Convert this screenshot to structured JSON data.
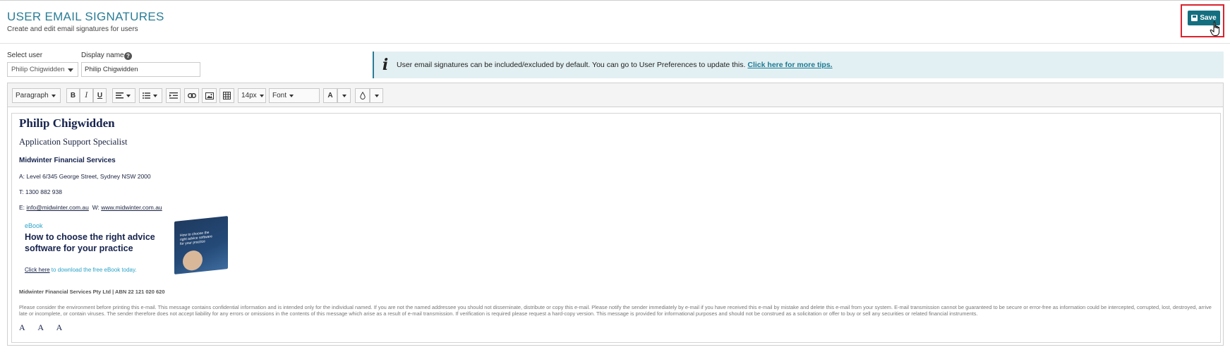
{
  "header": {
    "title": "USER EMAIL SIGNATURES",
    "subtitle": "Create and edit email signatures for users",
    "save_label": "Save"
  },
  "form": {
    "select_user_label": "Select user",
    "select_user_value": "Philip Chigwidden",
    "display_name_label": "Display name",
    "display_name_value": "Philip Chigwidden",
    "help_glyph": "?"
  },
  "info_banner": {
    "text": "User email signatures can be included/excluded by default. You can go to User Preferences to update this.",
    "link": "Click here for more tips."
  },
  "toolbar": {
    "paragraph": "Paragraph",
    "bold": "B",
    "italic": "I",
    "underline": "U",
    "font_size": "14px",
    "font": "Font",
    "text_color": "A"
  },
  "signature": {
    "name": "Philip Chigwidden",
    "role": "Application Support Specialist",
    "company": "Midwinter Financial Services",
    "address": "A: Level 6/345 George Street, Sydney NSW 2000",
    "phone": "T: 1300 882 938",
    "email_prefix": "E: ",
    "email": "info@midwinter.com.au",
    "web_prefix": "W: ",
    "web": "www.midwinter.com.au",
    "ebook_tag": "eBook",
    "ebook_title": "How to choose the right advice software for your practice",
    "ebook_cover_text": "How to choose the right advice software for your practice",
    "ebook_link": "Click here",
    "ebook_cta": " to download the free eBook today.",
    "legal_company": "Midwinter Financial Services Pty Ltd | ABN 22 121 020 620",
    "disclaimer": "Please consider the environment before printing this e-mail. This message contains confidential information and is intended only for the individual named.  If you are not the named addressee you should not disseminate, distribute or copy this e-mail. Please notify the sender immediately by e-mail if you have received this e-mail by mistake and delete this e-mail from your system. E-mail transmission cannot be guaranteed to be secure or error-free as information could be intercepted, corrupted, lost, destroyed, arrive late or incomplete, or contain viruses. The sender therefore does not accept liability for any errors or omissions in the contents of this message which arise as a result of e-mail transmission. If verification is required please request a hard-copy version. This message is provided for informational purposes and should not be construed as a solicitation or offer to buy or sell any securities or related financial instruments.",
    "font_size_glyphs": "A A A"
  },
  "colors": {
    "accent": "#2a7d96",
    "save_button": "#136f80",
    "save_highlight": "#d9232e",
    "banner_bg": "#e3f0f3",
    "navy": "#16234d"
  }
}
